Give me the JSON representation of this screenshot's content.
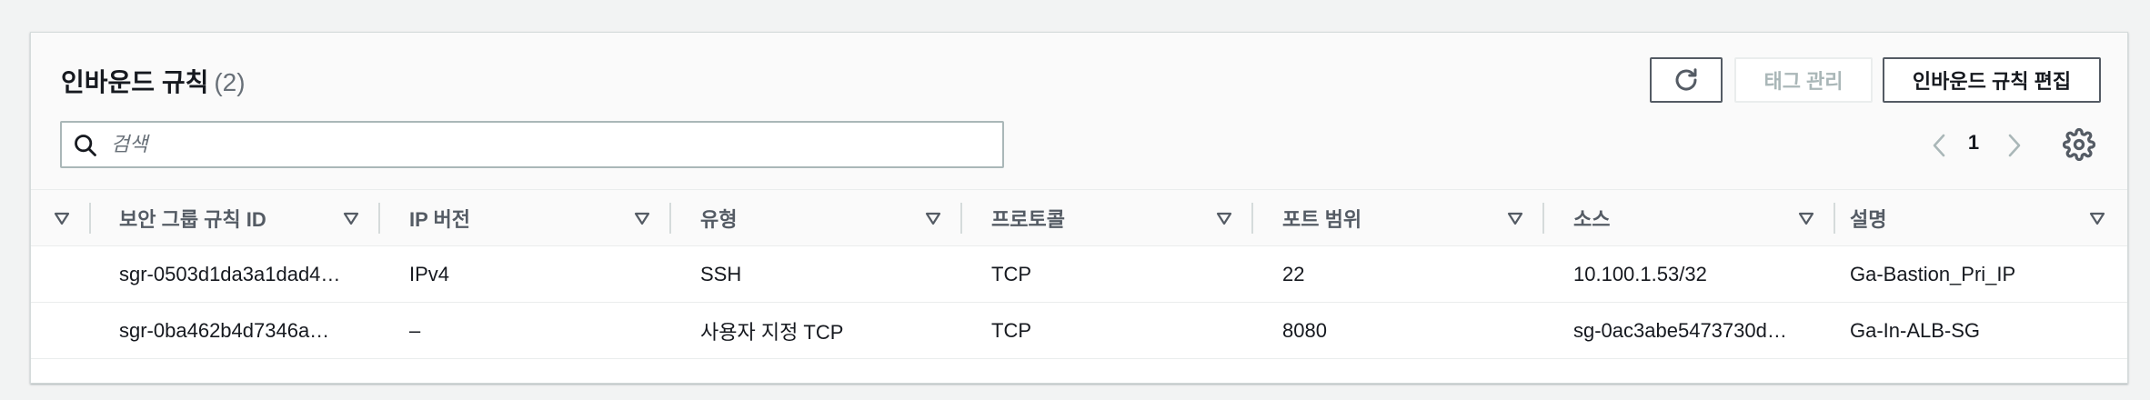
{
  "panel": {
    "title": "인바운드 규칙",
    "count": "(2)",
    "buttons": {
      "manage_tags": "태그 관리",
      "edit_inbound_rules": "인바운드 규칙 편집"
    },
    "search": {
      "placeholder": "검색",
      "value": ""
    },
    "pagination": {
      "current_page": "1"
    }
  },
  "table": {
    "columns": [
      "보안 그룹 규칙 ID",
      "IP 버전",
      "유형",
      "프로토콜",
      "포트 범위",
      "소스",
      "설명"
    ],
    "rows": [
      [
        "sgr-0503d1da3a1dad4…",
        "IPv4",
        "SSH",
        "TCP",
        "22",
        "10.100.1.53/32",
        "Ga-Bastion_Pri_IP"
      ],
      [
        "sgr-0ba462b4d7346a…",
        "–",
        "사용자 지정 TCP",
        "TCP",
        "8080",
        "sg-0ac3abe5473730d…",
        "Ga-In-ALB-SG"
      ]
    ]
  },
  "icons": {
    "refresh": "refresh-icon",
    "search": "search-icon",
    "prev": "chevron-left-icon",
    "next": "chevron-right-icon",
    "settings": "gear-icon",
    "sort": "sort-down-icon"
  },
  "colors": {
    "text": "#16191f",
    "muted": "#545b64",
    "disabled": "#aab7b8",
    "border": "#d5dbdb"
  }
}
